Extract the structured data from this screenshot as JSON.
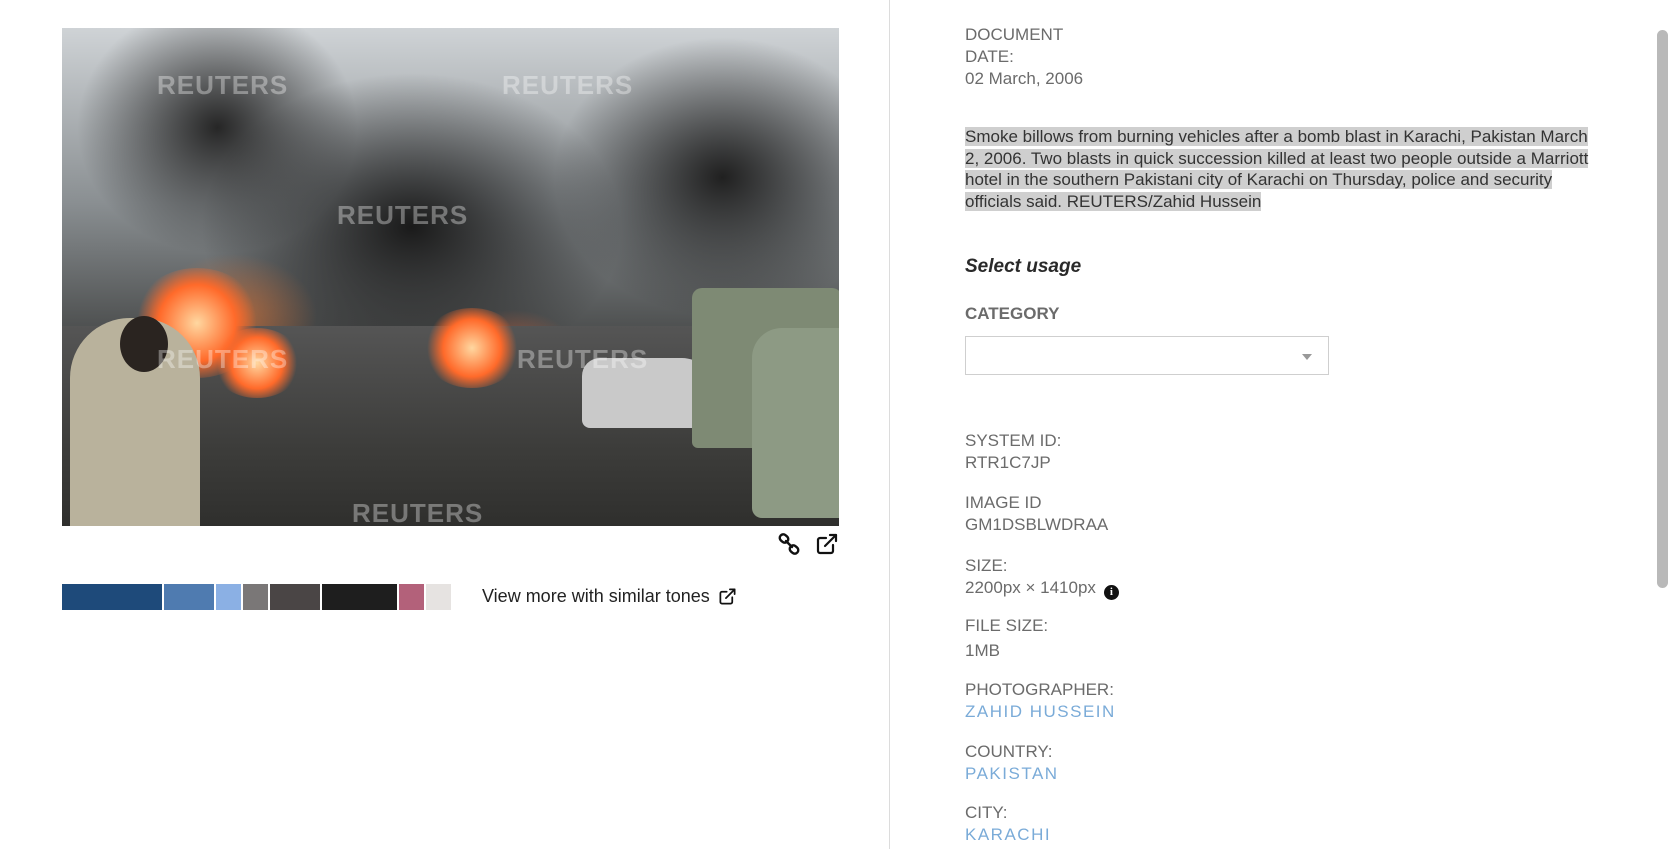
{
  "image": {
    "watermarks": [
      "REUTERS",
      "REUTERS",
      "REUTERS",
      "REUTERS",
      "REUTERS",
      "REUTERS"
    ],
    "tools": {
      "link_icon": "link-icon",
      "open_icon": "external-link-icon"
    }
  },
  "tones": {
    "swatches": [
      {
        "color": "#1e4a7a"
      },
      {
        "color": "#4f7bb0"
      },
      {
        "color": "#8bb0e4"
      },
      {
        "color": "#7a7777"
      },
      {
        "color": "#4a4545"
      },
      {
        "color": "#1e1e1e"
      },
      {
        "color": "#b3617a"
      },
      {
        "color": "#e6e3e1"
      }
    ],
    "link_label": "View more with similar tones",
    "link_icon": "external-link-icon"
  },
  "details": {
    "document_date_label": "DOCUMENT DATE:",
    "document_date": "02 March, 2006",
    "caption": "Smoke billows from burning vehicles after a bomb blast in Karachi, Pakistan March 2, 2006. Two blasts in quick succession killed at least two people outside a Marriott hotel in the southern Pakistani city of Karachi on Thursday, police and security officials said. REUTERS/Zahid Hussein",
    "select_usage": "Select usage",
    "category_label": "CATEGORY",
    "category_value": "",
    "system_id_label": "SYSTEM ID:",
    "system_id": "RTR1C7JP",
    "image_id_label": "IMAGE ID",
    "image_id": "GM1DSBLWDRAA",
    "size_label": "SIZE:",
    "size": "2200px × 1410px",
    "file_size_label": "FILE SIZE:",
    "file_size": "1MB",
    "photographer_label": "PHOTOGRAPHER:",
    "photographer": "ZAHID HUSSEIN",
    "country_label": "COUNTRY:",
    "country": "PAKISTAN",
    "city_label": "CITY:",
    "city": "KARACHI"
  }
}
